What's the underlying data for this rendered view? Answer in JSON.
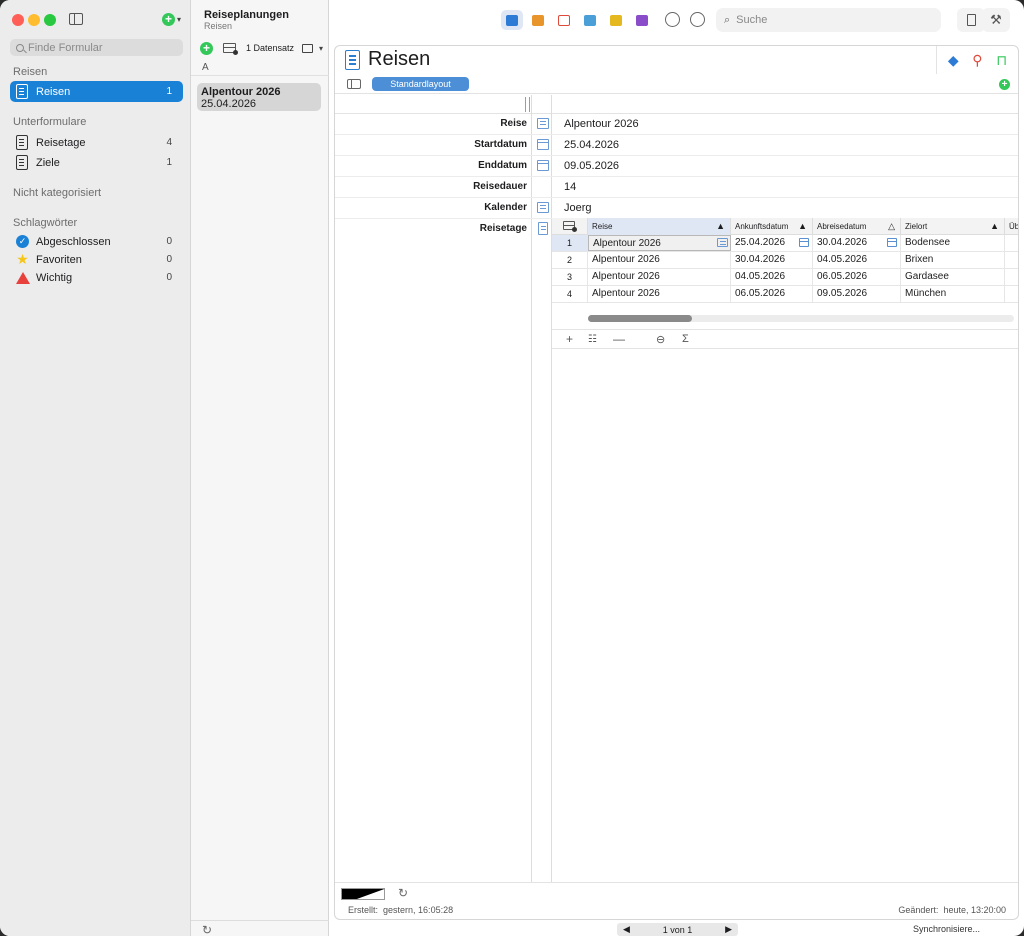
{
  "app": {
    "title": "Reiseplanungen",
    "subtitle": "Reisen"
  },
  "sidebar": {
    "search_placeholder": "Finde Formular",
    "section_main": "Reisen",
    "main_items": [
      {
        "label": "Reisen",
        "count": "1"
      }
    ],
    "section_sub": "Unterformulare",
    "sub_items": [
      {
        "label": "Reisetage",
        "count": "4"
      },
      {
        "label": "Ziele",
        "count": "1"
      }
    ],
    "section_uncat": "Nicht kategorisiert",
    "section_tags": "Schlagwörter",
    "tags": [
      {
        "label": "Abgeschlossen",
        "count": "0",
        "icon": "checkmark-circle-icon",
        "color": "#1a82d6"
      },
      {
        "label": "Favoriten",
        "count": "0",
        "icon": "star-icon",
        "color": "#f5c518"
      },
      {
        "label": "Wichtig",
        "count": "0",
        "icon": "triangle-icon",
        "color": "#e8413c"
      }
    ]
  },
  "list": {
    "records_label": "1 Datensatz",
    "group_letter": "A",
    "items": [
      {
        "name": "Alpentour 2026",
        "date": "25.04.2026"
      }
    ]
  },
  "toolbar": {
    "search_placeholder": "Suche",
    "view_icons": [
      "form-view-icon",
      "table-view-icon",
      "calendar-view-icon",
      "map-view-icon",
      "tiles-view-icon",
      "chart-view-icon"
    ]
  },
  "form": {
    "title": "Reisen",
    "layout_name": "Standardlayout",
    "fields": [
      {
        "label": "Reise",
        "value": "Alpentour 2026",
        "icon": "list"
      },
      {
        "label": "Startdatum",
        "value": "25.04.2026",
        "icon": "cal"
      },
      {
        "label": "Enddatum",
        "value": "09.05.2026",
        "icon": "cal"
      },
      {
        "label": "Reisedauer",
        "value": "14",
        "icon": ""
      },
      {
        "label": "Kalender",
        "value": "Joerg",
        "icon": "list"
      }
    ],
    "subtable_label": "Reisetage",
    "subtable": {
      "columns": [
        "Reise",
        "Ankunftsdatum",
        "Abreisedatum",
        "Zielort",
        "Üb"
      ],
      "rows": [
        {
          "num": "1",
          "reise": "Alpentour 2026",
          "ankunft": "25.04.2026",
          "abreise": "30.04.2026",
          "ziel": "Bodensee"
        },
        {
          "num": "2",
          "reise": "Alpentour 2026",
          "ankunft": "30.04.2026",
          "abreise": "04.05.2026",
          "ziel": "Brixen"
        },
        {
          "num": "3",
          "reise": "Alpentour 2026",
          "ankunft": "04.05.2026",
          "abreise": "06.05.2026",
          "ziel": "Gardasee"
        },
        {
          "num": "4",
          "reise": "Alpentour 2026",
          "ankunft": "06.05.2026",
          "abreise": "09.05.2026",
          "ziel": "München"
        }
      ]
    }
  },
  "status": {
    "created_label": "Erstellt:",
    "created_value": "gestern, 16:05:28",
    "changed_label": "Geändert:",
    "changed_value": "heute, 13:20:00",
    "pager": "1 von 1",
    "sync": "Synchronisiere..."
  }
}
